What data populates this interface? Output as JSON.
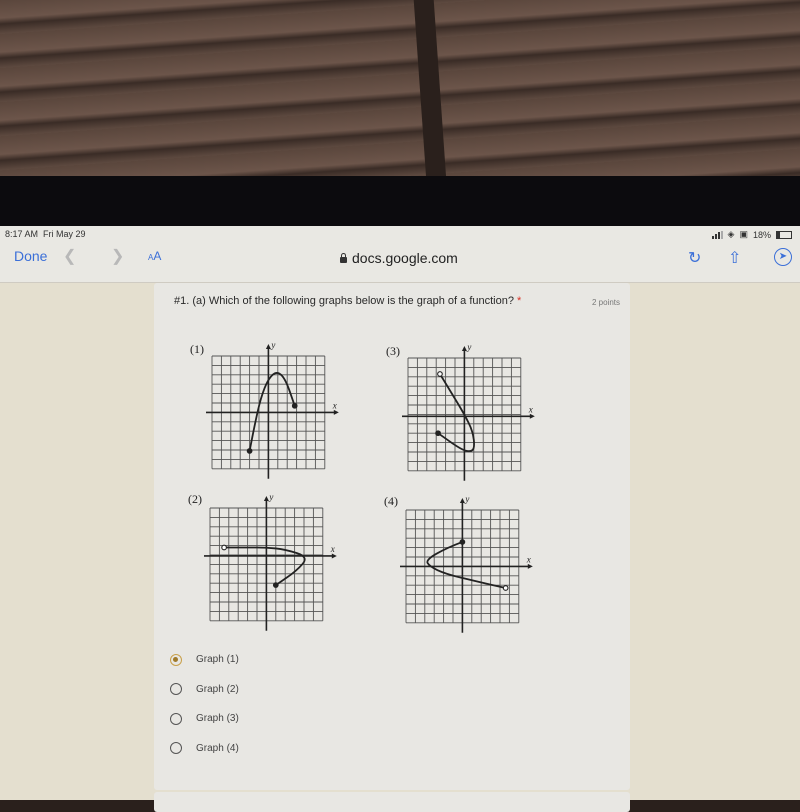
{
  "status_bar": {
    "time": "8:17 AM",
    "date": "Fri May 29",
    "battery": "18%"
  },
  "browser": {
    "done_label": "Done",
    "back_icon": "chevron-left-icon",
    "forward_icon": "chevron-right-icon",
    "text_size_label": "AA",
    "url": "docs.google.com",
    "reload_icon": "reload-icon",
    "share_icon": "share-icon",
    "safari_icon": "compass-icon"
  },
  "form": {
    "question": "#1. (a) Which of the following graphs below is the graph of a function?",
    "required_marker": "*",
    "points": "2 points",
    "graphs": [
      {
        "label": "(1)",
        "axis_x": "x",
        "axis_y": "y"
      },
      {
        "label": "(2)",
        "axis_x": "x",
        "axis_y": "y"
      },
      {
        "label": "(3)",
        "axis_x": "x",
        "axis_y": "y"
      },
      {
        "label": "(4)",
        "axis_x": "x",
        "axis_y": "y"
      }
    ],
    "options": [
      {
        "label": "Graph (1)",
        "selected": true
      },
      {
        "label": "Graph (2)",
        "selected": false
      },
      {
        "label": "Graph (3)",
        "selected": false
      },
      {
        "label": "Graph (4)",
        "selected": false
      }
    ],
    "accent_color": "#c9a04a"
  }
}
